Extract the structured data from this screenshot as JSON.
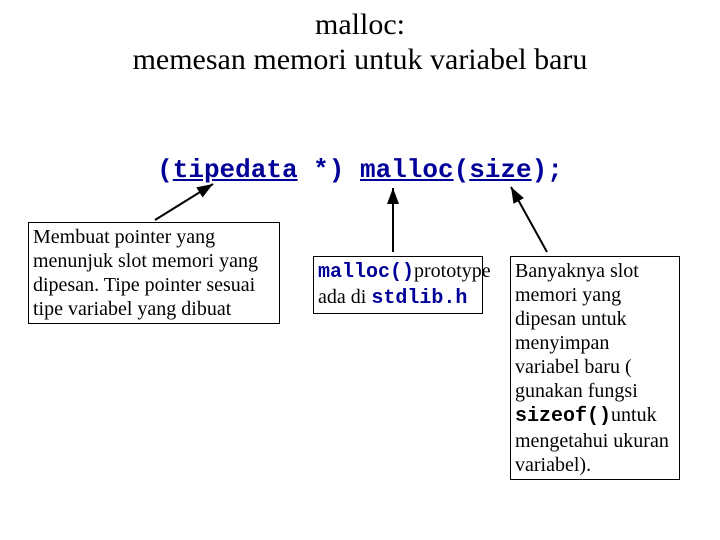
{
  "title_line1": "malloc:",
  "title_line2": "memesan memori untuk variabel baru",
  "code": {
    "part_cast_open": "(",
    "part_tipedata": "tipedata",
    "part_cast_close": " *) ",
    "part_malloc": "malloc",
    "part_open": "(",
    "part_size": "size",
    "part_close": ");"
  },
  "left_box": {
    "text": "Membuat pointer yang menunjuk slot memori yang dipesan. Tipe pointer sesuai tipe variabel yang dibuat"
  },
  "mid_box": {
    "malloc": "malloc()",
    "after_malloc": "prototype ada di ",
    "stdlib": "stdlib.h"
  },
  "right_box": {
    "t1": "Banyaknya slot memori yang dipesan untuk menyimpan variabel baru ( gunakan fungsi ",
    "sizeof": "sizeof()",
    "t2": "untuk mengetahui ukuran variabel)."
  }
}
